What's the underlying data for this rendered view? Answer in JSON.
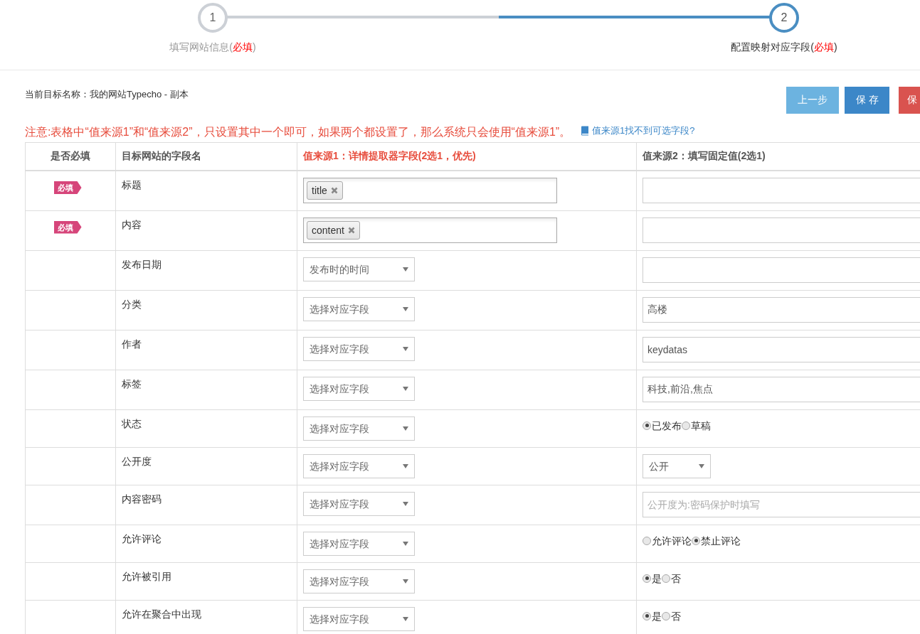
{
  "steps": [
    {
      "number": "1",
      "label": "填写网站信息(",
      "required": "必填",
      "close": ")",
      "selected": false
    },
    {
      "number": "2",
      "label": "配置映射对应字段(",
      "required": "必填",
      "close": ")",
      "selected": true
    }
  ],
  "target_name": "当前目标名称：我的网站Typecho - 副本",
  "buttons": [
    {
      "label": "上一步",
      "kind": "prev"
    },
    {
      "label": "保存",
      "kind": "save"
    },
    {
      "label": "保",
      "kind": "danger"
    }
  ],
  "notice": "注意:表格中“值来源1”和“值来源2”，只设置其中一个即可，如果两个都设置了，那么系统只会使用“值来源1”。",
  "help_link": "值来源1找不到可选字段?",
  "table": {
    "columns": [
      {
        "label": "是否必填",
        "highlight": false
      },
      {
        "label": "目标网站的字段名",
        "highlight": false
      },
      {
        "label": "值来源1：详情提取器字段(2选1，优先)",
        "highlight": true
      },
      {
        "label": "值来源2：填写固定值(2选1)",
        "highlight": false
      }
    ],
    "rows": [
      {
        "required": "必填",
        "field": "标题",
        "source1": {
          "kind": "tags",
          "tags": [
            "title"
          ]
        },
        "source2": {
          "kind": "text"
        }
      },
      {
        "required": "必填",
        "field": "内容",
        "source1": {
          "kind": "tags",
          "tags": [
            "content"
          ]
        },
        "source2": {
          "kind": "text"
        }
      },
      {
        "field": "发布日期",
        "source1": {
          "kind": "select",
          "value": "发布时的时间"
        },
        "source2": {
          "kind": "text"
        }
      },
      {
        "field": "分类",
        "source1": {
          "kind": "select",
          "value": "选择对应字段"
        },
        "source2": {
          "kind": "text",
          "value": "高楼"
        }
      },
      {
        "field": "作者",
        "source1": {
          "kind": "select",
          "value": "选择对应字段"
        },
        "source2": {
          "kind": "text",
          "value": "keydatas"
        }
      },
      {
        "field": "标签",
        "source1": {
          "kind": "select",
          "value": "选择对应字段"
        },
        "source2": {
          "kind": "text",
          "value": "科技,前沿,焦点"
        }
      },
      {
        "field": "状态",
        "source1": {
          "kind": "select",
          "value": "选择对应字段"
        },
        "source2": {
          "kind": "radio",
          "options": [
            {
              "label": "已发布",
              "selected": true
            },
            {
              "label": "草稿",
              "selected": false
            }
          ]
        }
      },
      {
        "field": "公开度",
        "source1": {
          "kind": "select",
          "value": "选择对应字段"
        },
        "source2": {
          "kind": "select",
          "value": "公开"
        }
      },
      {
        "field": "内容密码",
        "source1": {
          "kind": "select",
          "value": "选择对应字段"
        },
        "source2": {
          "kind": "text",
          "placeholder": "公开度为:密码保护时填写"
        }
      },
      {
        "field": "允许评论",
        "source1": {
          "kind": "select",
          "value": "选择对应字段"
        },
        "source2": {
          "kind": "radio",
          "options": [
            {
              "label": "允许评论",
              "selected": false
            },
            {
              "label": "禁止评论",
              "selected": true
            }
          ]
        }
      },
      {
        "field": "允许被引用",
        "source1": {
          "kind": "select",
          "value": "选择对应字段"
        },
        "source2": {
          "kind": "radio",
          "options": [
            {
              "label": "是",
              "selected": true
            },
            {
              "label": "否",
              "selected": false
            }
          ]
        }
      },
      {
        "field": "允许在聚合中出现",
        "source1": {
          "kind": "select",
          "value": "选择对应字段"
        },
        "source2": {
          "kind": "radio",
          "options": [
            {
              "label": "是",
              "selected": true
            },
            {
              "label": "否",
              "selected": false
            }
          ]
        }
      }
    ]
  }
}
